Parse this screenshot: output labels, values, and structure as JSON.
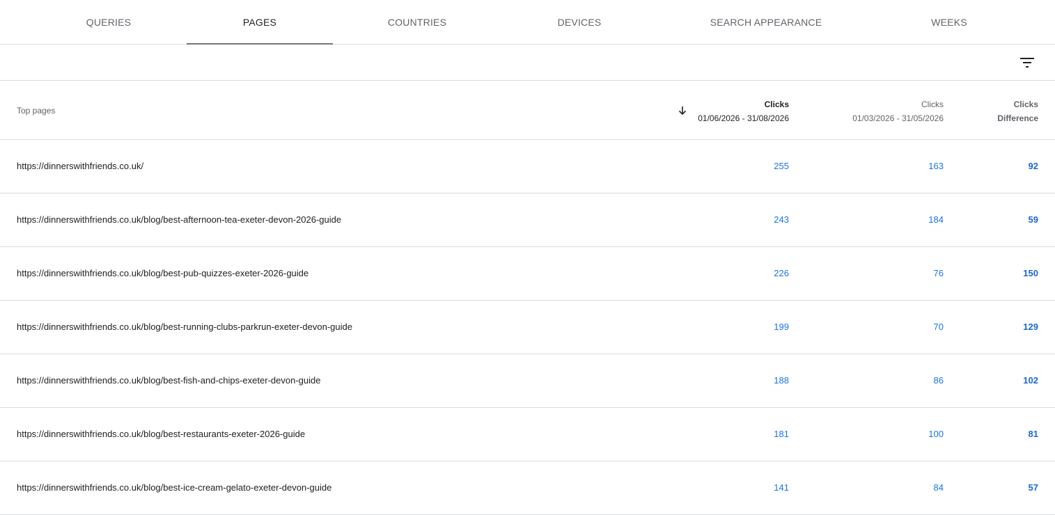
{
  "tabs": [
    {
      "label": "QUERIES",
      "active": false
    },
    {
      "label": "PAGES",
      "active": true
    },
    {
      "label": "COUNTRIES",
      "active": false
    },
    {
      "label": "DEVICES",
      "active": false
    },
    {
      "label": "SEARCH APPEARANCE",
      "active": false
    },
    {
      "label": "WEEKS",
      "active": false
    }
  ],
  "table": {
    "first_column_header": "Top pages",
    "columns": [
      {
        "metric": "Clicks",
        "sub": "01/06/2026 - 31/08/2026",
        "sorted": "descending"
      },
      {
        "metric": "Clicks",
        "sub": "01/03/2026 - 31/05/2026"
      },
      {
        "metric": "Clicks",
        "sub": "Difference"
      }
    ],
    "rows": [
      {
        "page": "https://dinnerswithfriends.co.uk/",
        "current": "255",
        "previous": "163",
        "difference": "92"
      },
      {
        "page": "https://dinnerswithfriends.co.uk/blog/best-afternoon-tea-exeter-devon-2026-guide",
        "current": "243",
        "previous": "184",
        "difference": "59"
      },
      {
        "page": "https://dinnerswithfriends.co.uk/blog/best-pub-quizzes-exeter-2026-guide",
        "current": "226",
        "previous": "76",
        "difference": "150"
      },
      {
        "page": "https://dinnerswithfriends.co.uk/blog/best-running-clubs-parkrun-exeter-devon-guide",
        "current": "199",
        "previous": "70",
        "difference": "129"
      },
      {
        "page": "https://dinnerswithfriends.co.uk/blog/best-fish-and-chips-exeter-devon-guide",
        "current": "188",
        "previous": "86",
        "difference": "102"
      },
      {
        "page": "https://dinnerswithfriends.co.uk/blog/best-restaurants-exeter-2026-guide",
        "current": "181",
        "previous": "100",
        "difference": "81"
      },
      {
        "page": "https://dinnerswithfriends.co.uk/blog/best-ice-cream-gelato-exeter-devon-guide",
        "current": "141",
        "previous": "84",
        "difference": "57"
      }
    ]
  },
  "icons": {
    "filter": "filter-list-icon",
    "sort": "arrow-downward-icon"
  },
  "colors": {
    "accent_link": "#1a73e8",
    "tab_indicator": "#757575",
    "divider": "#dadce0"
  }
}
